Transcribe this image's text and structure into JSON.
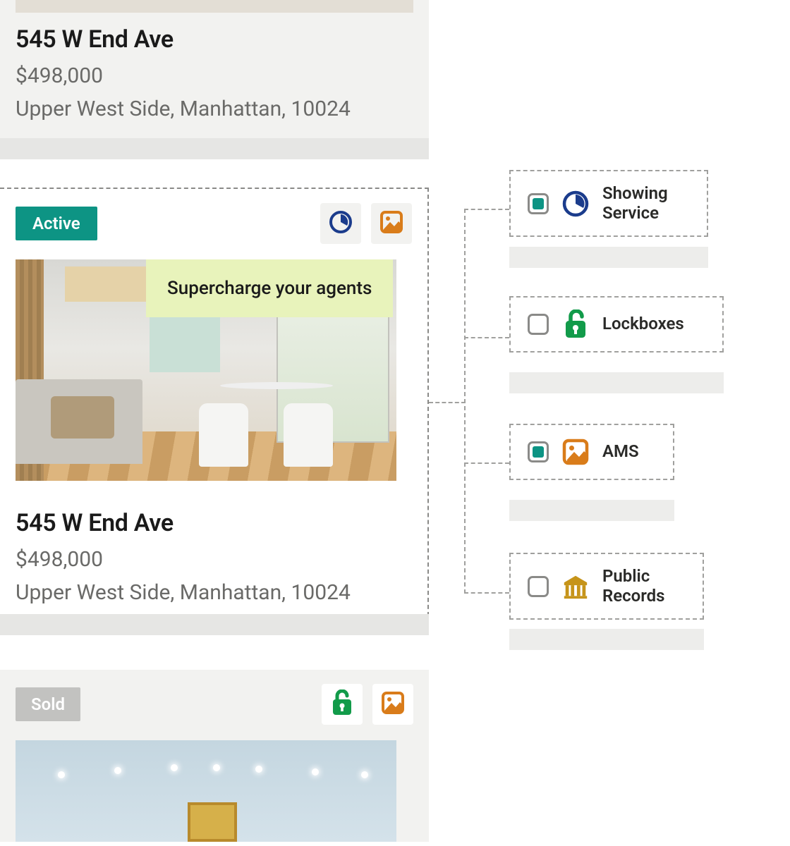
{
  "card1": {
    "address": "545 W End Ave",
    "price": "$498,000",
    "location": "Upper West Side, Manhattan, 10024"
  },
  "card2": {
    "status": "Active",
    "callout": "Supercharge your agents",
    "address": "545 W End Ave",
    "price": "$498,000",
    "location": "Upper West Side, Manhattan, 10024"
  },
  "card3": {
    "status": "Sold"
  },
  "integrations": {
    "showing": {
      "label": "Showing Service",
      "checked": true
    },
    "lockboxes": {
      "label": "Lockboxes",
      "checked": false
    },
    "ams": {
      "label": "AMS",
      "checked": true
    },
    "public_records": {
      "label": "Public Records",
      "checked": false
    }
  }
}
